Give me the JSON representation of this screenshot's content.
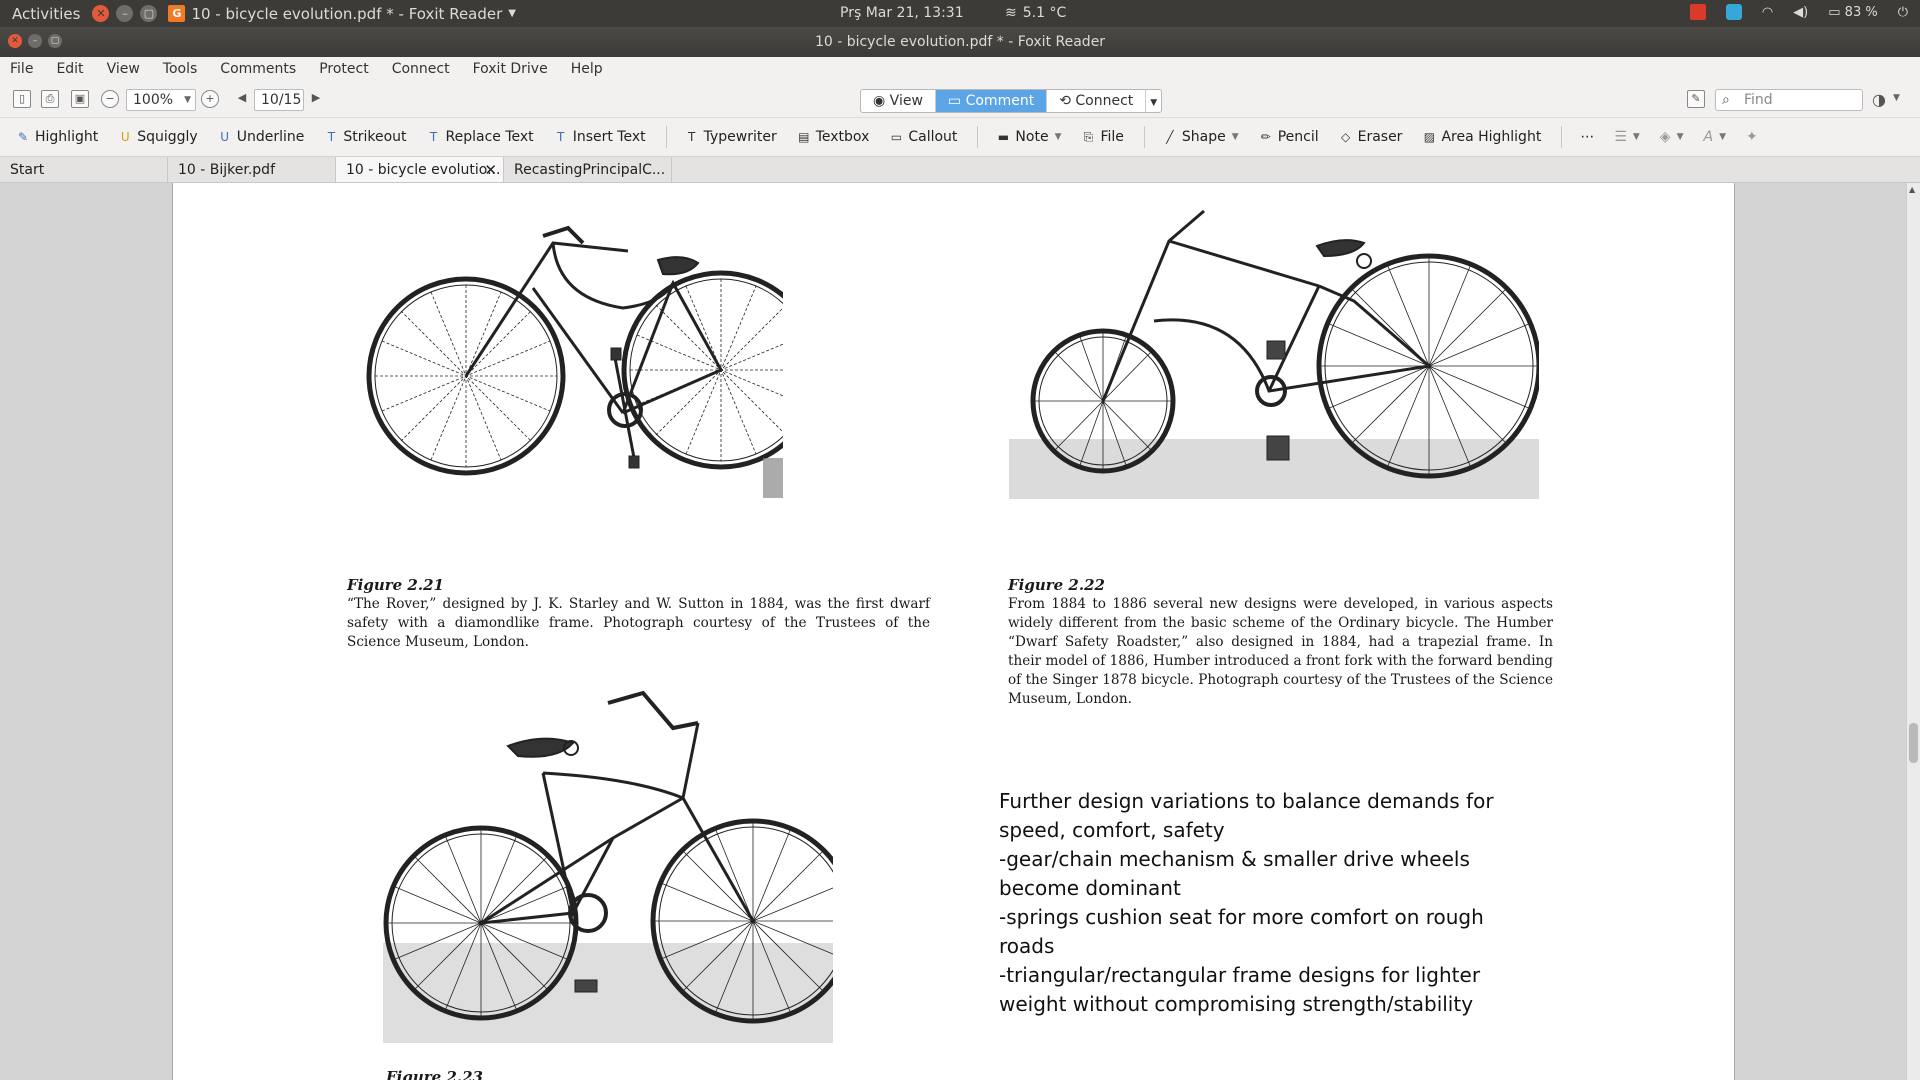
{
  "system_bar": {
    "activities": "Activities",
    "app_indicator": "10 - bicycle evolution.pdf * - Foxit Reader",
    "clock": "Prş Mar 21, 13:31",
    "weather": "5.1 °C",
    "battery": "83 %"
  },
  "window": {
    "title": "10 - bicycle evolution.pdf * - Foxit Reader"
  },
  "menu": [
    "File",
    "Edit",
    "View",
    "Tools",
    "Comments",
    "Protect",
    "Connect",
    "Foxit Drive",
    "Help"
  ],
  "toolbar": {
    "zoom": "100%",
    "page": "10/15",
    "modes": [
      "View",
      "Comment",
      "Connect"
    ],
    "active_mode": "Comment",
    "find_placeholder": "Find"
  },
  "comment_tools": [
    "Highlight",
    "Squiggly",
    "Underline",
    "Strikeout",
    "Replace Text",
    "Insert Text",
    "Typewriter",
    "Textbox",
    "Callout",
    "Note",
    "File",
    "Shape",
    "Pencil",
    "Eraser",
    "Area Highlight"
  ],
  "tabs": [
    {
      "label": "Start",
      "active": false
    },
    {
      "label": "10 - Bijker.pdf",
      "active": false
    },
    {
      "label": "10 - bicycle evolutio...",
      "active": true
    },
    {
      "label": "RecastingPrincipalC...",
      "active": false
    }
  ],
  "document": {
    "fig21": {
      "label": "Figure 2.21",
      "caption": "“The Rover,” designed by J. K. Starley and W. Sutton in 1884, was the first dwarf safety with a diamondlike frame. Photograph courtesy of the Trustees of the Science Museum, London."
    },
    "fig22": {
      "label": "Figure 2.22",
      "caption": "From 1884 to 1886 several new designs were developed, in various aspects widely different from the basic scheme of the Ordinary bicycle. The Humber “Dwarf Safety Roadster,” also designed in 1884, had a trapezial frame. In their model of 1886, Humber introduced a front fork with the forward bending of the Singer 1878 bicycle. Photograph courtesy of the Trustees of the Science Museum, London."
    },
    "fig23_label": "Figure 2.23",
    "notes": [
      "Further design variations to balance demands for speed, comfort, safety",
      "-gear/chain mechanism & smaller drive wheels become dominant",
      "-springs cushion seat for more comfort on rough roads",
      "-triangular/rectangular frame designs for lighter weight without compromising strength/stability"
    ]
  },
  "colors": {
    "accent": "#5ba4e5",
    "ubuntu_bar": "#3c3b37",
    "close_button": "#e25a3b"
  }
}
